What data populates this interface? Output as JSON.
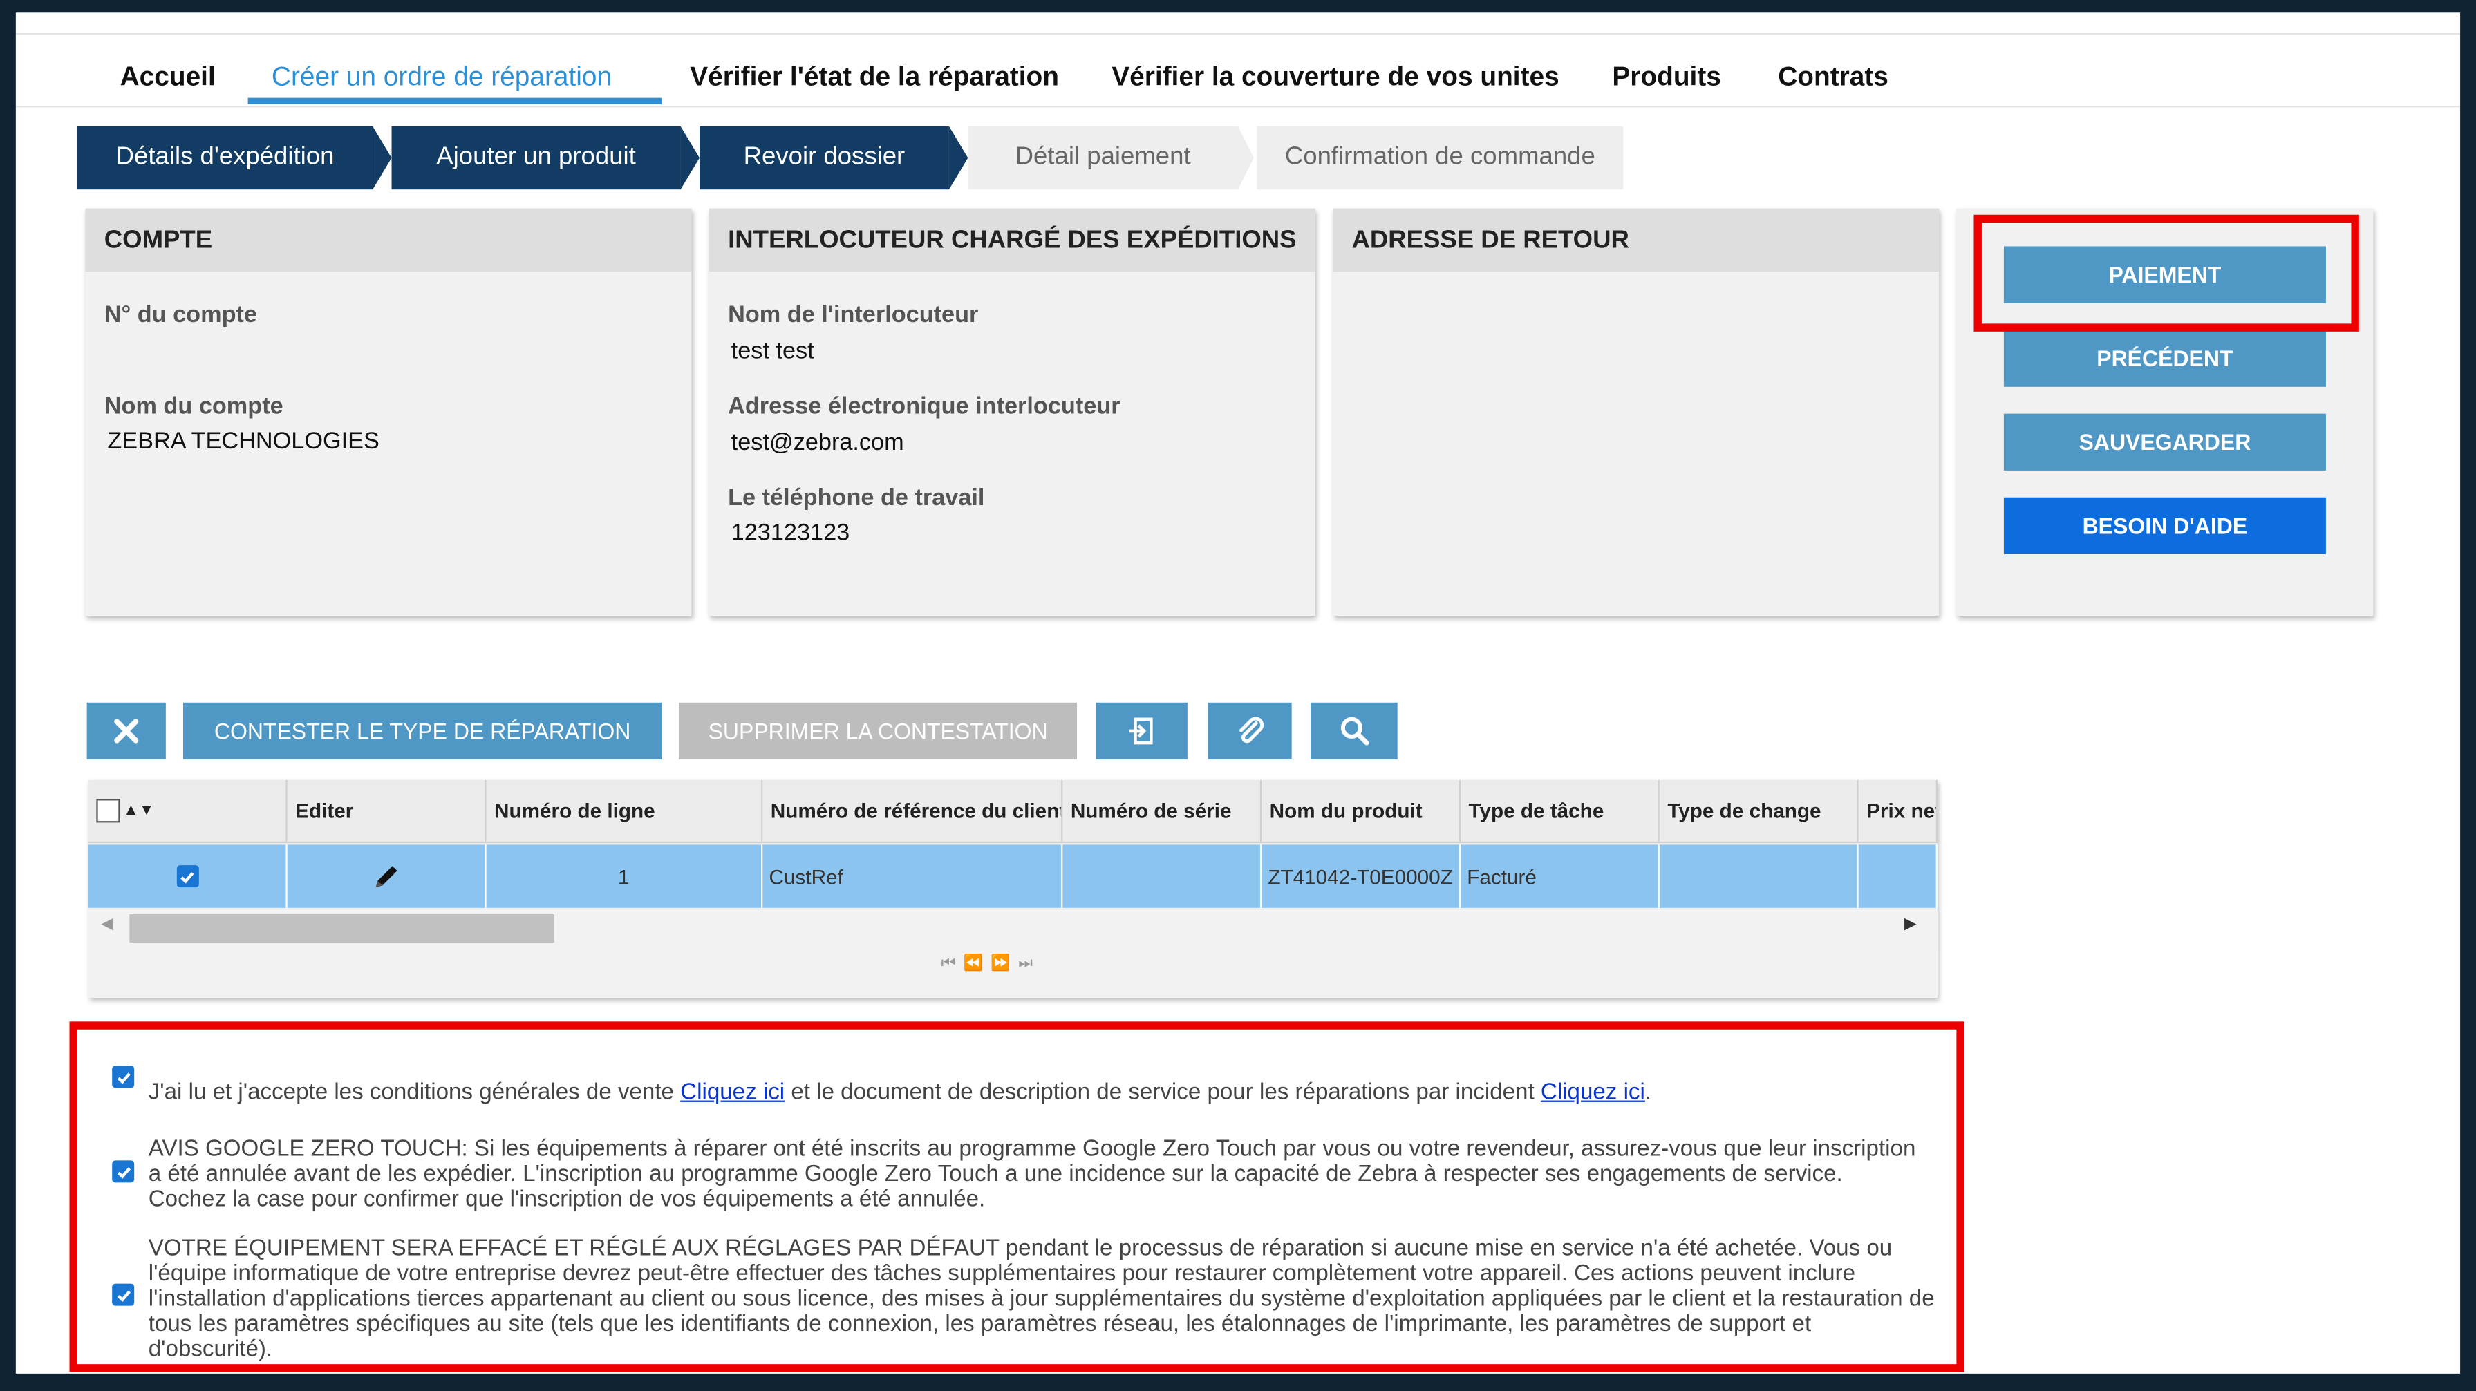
{
  "nav": {
    "items": [
      "Accueil",
      "Créer un ordre de réparation",
      "Vérifier l'état de la réparation",
      "Vérifier la couverture de vos unites",
      "Produits",
      "Contrats"
    ]
  },
  "steps": [
    "Détails d'expédition",
    "Ajouter un produit",
    "Revoir dossier",
    "Détail paiement",
    "Confirmation de commande"
  ],
  "panels": {
    "compte": {
      "title": "COMPTE",
      "account_number_label": "N° du compte",
      "account_number_value": "",
      "account_name_label": "Nom du compte",
      "account_name_value": "ZEBRA TECHNOLOGIES"
    },
    "contact": {
      "title": "INTERLOCUTEUR CHARGÉ DES EXPÉDITIONS",
      "name_label": "Nom de l'interlocuteur",
      "name_value": "test test",
      "email_label": "Adresse électronique interlocuteur",
      "email_value": "test@zebra.com",
      "phone_label": "Le téléphone de travail",
      "phone_value": "123123123"
    },
    "return": {
      "title": "ADRESSE DE RETOUR"
    }
  },
  "actions": {
    "payment": "PAIEMENT",
    "previous": "PRÉCÉDENT",
    "save": "SAUVEGARDER",
    "help": "BESOIN D'AIDE"
  },
  "toolbar": {
    "contest": "CONTESTER LE TYPE DE RÉPARATION",
    "remove_contest": "SUPPRIMER LA CONTESTATION"
  },
  "grid": {
    "columns": [
      "Editer",
      "Numéro de ligne",
      "Numéro de référence du client",
      "Numéro de série",
      "Nom du produit",
      "Type de tâche",
      "Type de change",
      "Prix net"
    ],
    "row": {
      "line_number": "1",
      "customer_ref": "CustRef",
      "serial": "",
      "product": "ZT41042-T0E0000Z",
      "task_type": "Facturé",
      "change_type": ""
    }
  },
  "terms": {
    "t1_a": "J'ai lu et j'accepte les conditions générales de vente ",
    "t1_link1": "Cliquez ici",
    "t1_b": " et le document de description de service pour les réparations par incident ",
    "t1_link2": "Cliquez ici",
    "t1_c": ".",
    "t2": "AVIS GOOGLE ZERO TOUCH: Si les équipements à réparer ont été inscrits au programme Google Zero Touch par vous ou votre revendeur, assurez-vous que leur inscription a été annulée avant de les expédier. L'inscription au programme Google Zero Touch a une incidence sur la capacité de Zebra à respecter ses engagements de service. Cochez la case pour confirmer que l'inscription de vos équipements a été annulée.",
    "t3": "VOTRE ÉQUIPEMENT SERA EFFACÉ ET RÉGLÉ AUX RÉGLAGES PAR DÉFAUT pendant le processus de réparation si aucune mise en service n'a été achetée. Vous ou l'équipe informatique de votre entreprise devrez peut-être effectuer des tâches supplémentaires pour restaurer complètement votre appareil. Ces actions peuvent inclure l'installation d'applications tierces appartenant au client ou sous licence, des mises à jour supplémentaires du système d'exploitation appliquées par le client et la restauration de tous les paramètres spécifiques au site (tels que les identifiants de connexion, les paramètres réseau, les étalonnages de l'imprimante, les paramètres de support et d'obscurité)."
  },
  "colors": {
    "accent": "#2f8fd5",
    "step_done": "#123c63",
    "button": "#4f97c5",
    "help_button": "#0d6ddf",
    "highlight": "#ee0000",
    "row_selected": "#8cc4f0"
  }
}
